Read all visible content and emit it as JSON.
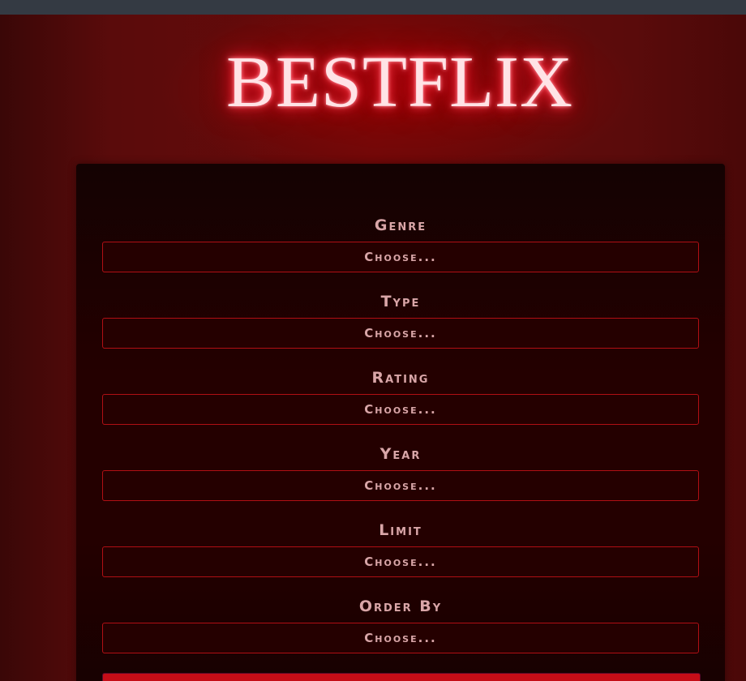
{
  "app": {
    "logo_text": "BESTFLIX"
  },
  "filters": [
    {
      "label": "Genre",
      "value": "Choose..."
    },
    {
      "label": "Type",
      "value": "Choose..."
    },
    {
      "label": "Rating",
      "value": "Choose..."
    },
    {
      "label": "Year",
      "value": "Choose..."
    },
    {
      "label": "Limit",
      "value": "Choose..."
    },
    {
      "label": "Order By",
      "value": "Choose..."
    }
  ],
  "colors": {
    "background": "#5a0b0b",
    "panel": "#240000",
    "accent": "#c50d17",
    "label_text": "#d9a6a8",
    "logo_glow": "#ff1e2e"
  }
}
